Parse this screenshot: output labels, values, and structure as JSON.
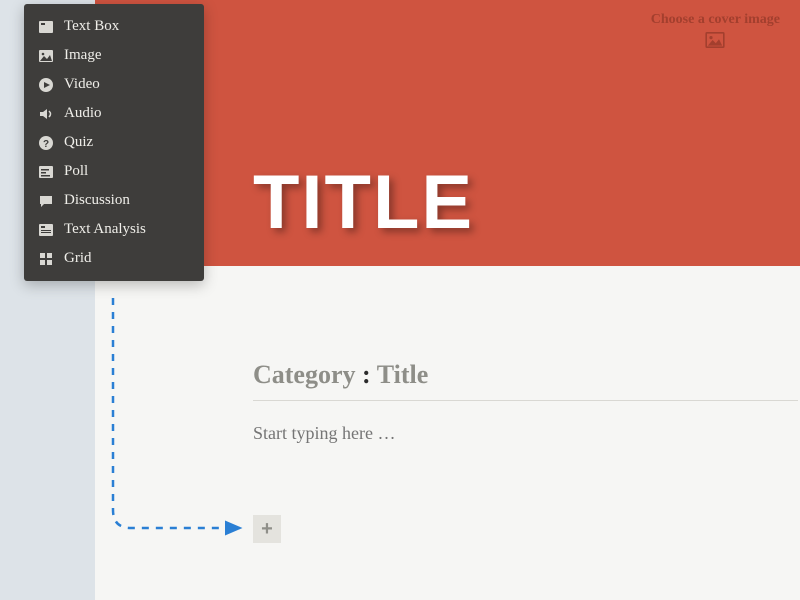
{
  "colors": {
    "hero_bg": "#cf5440",
    "page_bg": "#dde3e8",
    "canvas_bg": "#f6f6f4",
    "menu_bg": "#3e3d3b",
    "connector": "#2a7fd4"
  },
  "hero": {
    "title": "TITLE",
    "cover_link_label": "Choose a cover image"
  },
  "content": {
    "category_label": "Category",
    "separator": ":",
    "title_label": "Title",
    "body_placeholder": "Start typing here …"
  },
  "add_button": {
    "glyph": "+"
  },
  "insert_menu": {
    "items": [
      {
        "icon": "text-box-icon",
        "label": "Text Box"
      },
      {
        "icon": "image-icon",
        "label": "Image"
      },
      {
        "icon": "video-icon",
        "label": "Video"
      },
      {
        "icon": "audio-icon",
        "label": "Audio"
      },
      {
        "icon": "quiz-icon",
        "label": "Quiz"
      },
      {
        "icon": "poll-icon",
        "label": "Poll"
      },
      {
        "icon": "discussion-icon",
        "label": "Discussion"
      },
      {
        "icon": "text-analysis-icon",
        "label": "Text Analysis"
      },
      {
        "icon": "grid-icon",
        "label": "Grid"
      }
    ]
  }
}
